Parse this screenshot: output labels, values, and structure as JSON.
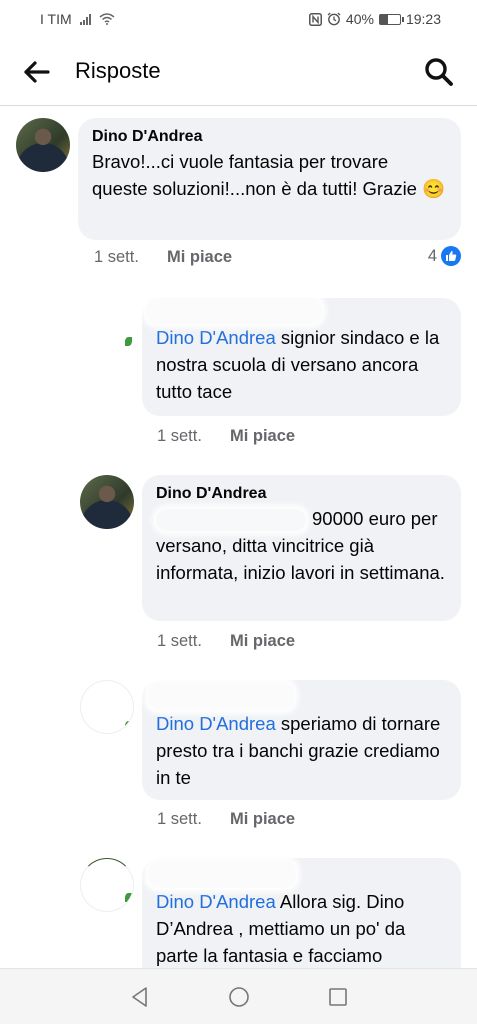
{
  "status": {
    "carrier": "I TIM",
    "battery": "40%",
    "time": "19:23",
    "battery_level": 0.4
  },
  "header": {
    "title": "Risposte"
  },
  "comments": [
    {
      "author": "Dino D'Andrea",
      "text": "Bravo!...ci vuole fantasia per trovare queste soluzioni!...non è da tutti! Grazie 😊",
      "time": "1 sett.",
      "like_label": "Mi piace",
      "likes": "4"
    },
    {
      "mention": "Dino D'Andrea",
      "text": " signior sindaco e la nostra scuola di versano ancora tutto tace",
      "time": "1 sett.",
      "like_label": "Mi piace"
    },
    {
      "author": "Dino D'Andrea",
      "text": "90000 euro per versano, ditta vincitrice già informata, inizio lavori in settimana.",
      "time": "1 sett.",
      "like_label": "Mi piace"
    },
    {
      "mention": "Dino D'Andrea",
      "text": " speriamo di tornare presto tra i banchi grazie crediamo in te",
      "time": "1 sett.",
      "like_label": "Mi piace"
    },
    {
      "mention": "Dino D'Andrea",
      "text": " Allora sig. Dino D’Andrea , mettiamo un po' da parte la fantasia e facciamo"
    }
  ],
  "icons": {
    "back": "arrow-left-icon",
    "search": "search-icon",
    "nav_back": "triangle-back-icon",
    "nav_home": "circle-home-icon",
    "nav_recent": "square-recent-icon",
    "like": "thumbs-up-icon"
  },
  "colors": {
    "mention": "#216fdb",
    "like_badge": "#1877f2",
    "bubble": "#f0f2f5",
    "meta_text": "#65676b"
  }
}
